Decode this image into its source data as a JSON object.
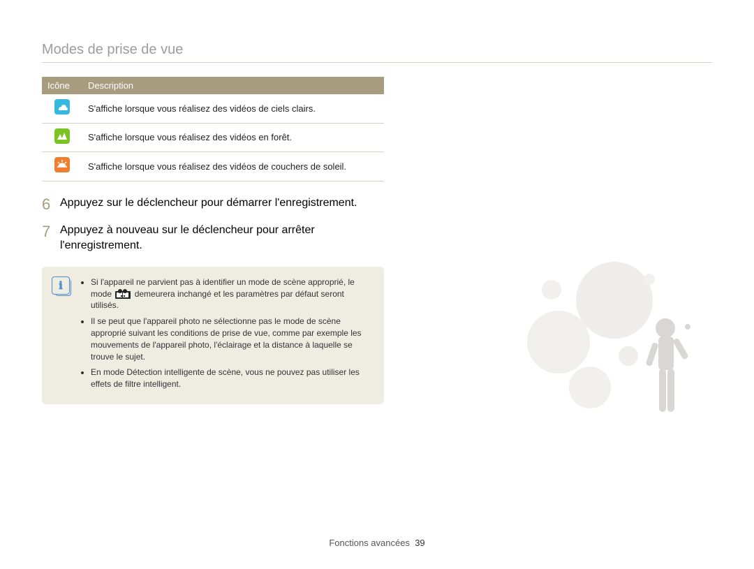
{
  "header": {
    "title": "Modes de prise de vue"
  },
  "table": {
    "head": {
      "icon": "Icône",
      "desc": "Description"
    },
    "rows": [
      {
        "icon": "sky",
        "desc": "S'affiche lorsque vous réalisez des vidéos de ciels clairs."
      },
      {
        "icon": "forest",
        "desc": "S'affiche lorsque vous réalisez des vidéos en forêt."
      },
      {
        "icon": "sunset",
        "desc": "S'affiche lorsque vous réalisez des vidéos de couchers de soleil."
      }
    ]
  },
  "steps": [
    {
      "num": "6",
      "text": "Appuyez sur le déclencheur pour démarrer l'enregistrement."
    },
    {
      "num": "7",
      "text": "Appuyez à nouveau sur le déclencheur pour arrêter l'enregistrement."
    }
  ],
  "note": {
    "items": [
      {
        "pre": "Si l'appareil ne parvient pas à identifier un mode de scène approprié, le mode ",
        "post": " demeurera inchangé et les paramètres par défaut seront utilisés.",
        "inline_icon": true
      },
      {
        "text": "Il se peut que l'appareil photo ne sélectionne pas le mode de scène approprié suivant les conditions de prise de vue, comme par exemple les mouvements de l'appareil photo, l'éclairage et la distance à laquelle se trouve le sujet."
      },
      {
        "text": "En mode Détection intelligente de scène, vous ne pouvez pas utiliser les effets de filtre intelligent."
      }
    ]
  },
  "footer": {
    "label": "Fonctions avancées",
    "page": "39"
  }
}
